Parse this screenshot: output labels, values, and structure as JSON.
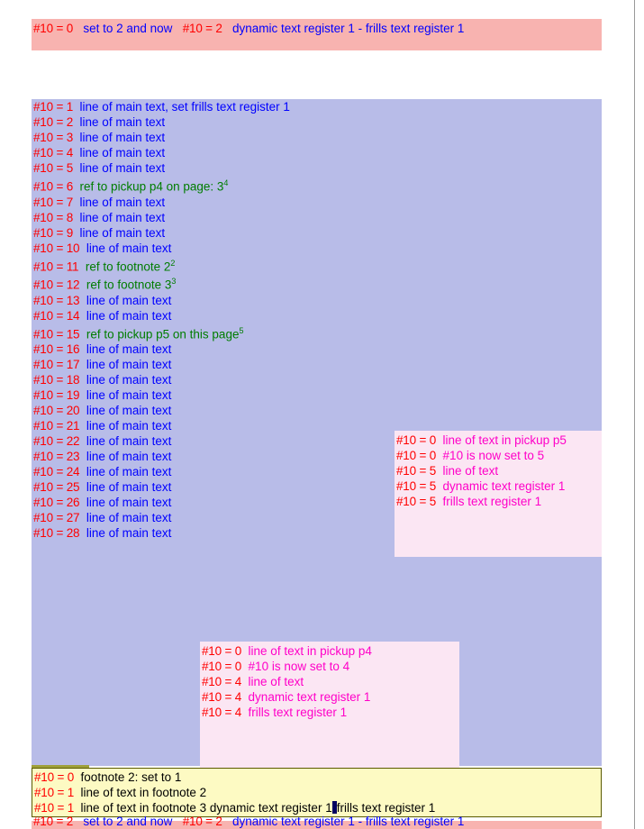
{
  "header": {
    "reg": "#10 = 0",
    "text_before": "set to 2 and now",
    "reg2": "#10 = 2",
    "text_after": "dynamic text register 1 - frills text register 1"
  },
  "main_lines": [
    {
      "reg": "#10 = 1",
      "text": "line of main text, set frills text register 1",
      "color": "blue"
    },
    {
      "reg": "#10 = 2",
      "text": "line of main text",
      "color": "blue"
    },
    {
      "reg": "#10 = 3",
      "text": "line of main text",
      "color": "blue"
    },
    {
      "reg": "#10 = 4",
      "text": "line of main text",
      "color": "blue"
    },
    {
      "reg": "#10 = 5",
      "text": "line of main text",
      "color": "blue"
    },
    {
      "reg": "#10 = 6",
      "text": "ref to pickup p4 on page: 3",
      "sup": "4",
      "color": "green"
    },
    {
      "reg": "#10 = 7",
      "text": "line of main text",
      "color": "blue"
    },
    {
      "reg": "#10 = 8",
      "text": "line of main text",
      "color": "blue"
    },
    {
      "reg": "#10 = 9",
      "text": "line of main text",
      "color": "blue"
    },
    {
      "reg": "#10 = 10",
      "text": "line of main text",
      "color": "blue"
    },
    {
      "reg": "#10 = 11",
      "text": "ref to footnote 2",
      "sup": "2",
      "color": "green"
    },
    {
      "reg": "#10 = 12",
      "text": "ref to footnote 3",
      "sup": "3",
      "color": "green"
    },
    {
      "reg": "#10 = 13",
      "text": "line of main text",
      "color": "blue"
    },
    {
      "reg": "#10 = 14",
      "text": "line of main text",
      "color": "blue"
    },
    {
      "reg": "#10 = 15",
      "text": "ref to pickup p5 on this page",
      "sup": "5",
      "color": "green"
    },
    {
      "reg": "#10 = 16",
      "text": "line of main text",
      "color": "blue"
    },
    {
      "reg": "#10 = 17",
      "text": "line of main text",
      "color": "blue"
    },
    {
      "reg": "#10 = 18",
      "text": "line of main text",
      "color": "blue"
    },
    {
      "reg": "#10 = 19",
      "text": "line of main text",
      "color": "blue"
    },
    {
      "reg": "#10 = 20",
      "text": "line of main text",
      "color": "blue"
    },
    {
      "reg": "#10 = 21",
      "text": "line of main text",
      "color": "blue"
    },
    {
      "reg": "#10 = 22",
      "text": "line of main text",
      "color": "blue"
    },
    {
      "reg": "#10 = 23",
      "text": "line of main text",
      "color": "blue"
    },
    {
      "reg": "#10 = 24",
      "text": "line of main text",
      "color": "blue"
    },
    {
      "reg": "#10 = 25",
      "text": "line of main text",
      "color": "blue"
    },
    {
      "reg": "#10 = 26",
      "text": "line of main text",
      "color": "blue"
    },
    {
      "reg": "#10 = 27",
      "text": "line of main text",
      "color": "blue"
    },
    {
      "reg": "#10 = 28",
      "text": "line of main text",
      "color": "blue"
    }
  ],
  "pickup_p5": [
    {
      "reg": "#10 = 0",
      "text": "line of text in pickup p5"
    },
    {
      "reg": "#10 = 0",
      "text": "#10 is now set to 5"
    },
    {
      "reg": "#10 = 5",
      "text": "line of text"
    },
    {
      "reg": "#10 = 5",
      "text": "dynamic text register 1"
    },
    {
      "reg": "#10 = 5",
      "text": "frills text register 1"
    }
  ],
  "pickup_p4": [
    {
      "reg": "#10 = 0",
      "text": "line of text in pickup p4"
    },
    {
      "reg": "#10 = 0",
      "text": "#10 is now set to 4"
    },
    {
      "reg": "#10 = 4",
      "text": "line of text"
    },
    {
      "reg": "#10 = 4",
      "text": "dynamic text register 1"
    },
    {
      "reg": "#10 = 4",
      "text": "frills text register 1"
    }
  ],
  "footnotes": [
    {
      "reg": "#10 = 0",
      "text": "footnote 2: set to 1",
      "cursor": false
    },
    {
      "reg": "#10 = 1",
      "text": "line of text in footnote 2",
      "cursor": false
    },
    {
      "reg": "#10 = 1",
      "text_a": "line of text in footnote 3 dynamic text register 1",
      "text_b": "frills text register 1",
      "cursor": true
    }
  ],
  "footer": {
    "reg": "#10 = 2",
    "text_before": "set to 2 and now",
    "reg2": "#10 = 2",
    "text_after": "dynamic text register 1 - frills text register 1"
  }
}
